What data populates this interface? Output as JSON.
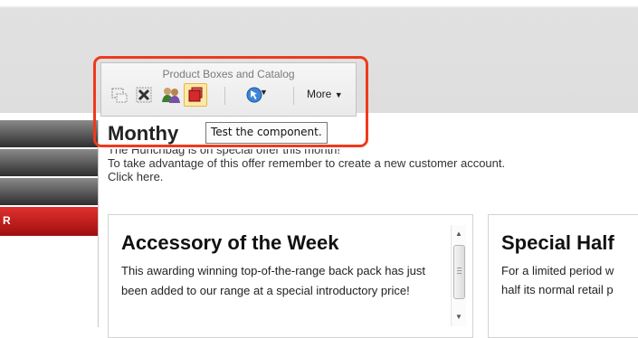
{
  "toolbar": {
    "title": "Product Boxes and Catalog",
    "buttons": [
      {
        "icon": "select-area-icon"
      },
      {
        "icon": "delete-x-icon"
      },
      {
        "icon": "users-icon"
      },
      {
        "icon": "test-component-icon",
        "highlighted": true
      },
      {
        "icon": "cursor-circle-icon",
        "has_dropdown": true
      }
    ],
    "more_label": "More",
    "tooltip": "Test the component.",
    "highlight_color": "#ef3a1c"
  },
  "nav": {
    "items": [
      {
        "label": ""
      },
      {
        "label": ""
      },
      {
        "label": ""
      },
      {
        "label": "R",
        "active": true
      }
    ],
    "active_color": "#c41e1d"
  },
  "content": {
    "title": "Monthy",
    "promo_line1": "The Hunchbag is on special offer this month!",
    "promo_line2": "To take advantage of this offer remember to create a new customer account.",
    "promo_line3": "Click here."
  },
  "boxes": [
    {
      "title": "Accessory of the Week",
      "text": "This awarding winning top-of-the-range back pack has just been added to our range at a special introductory price!"
    },
    {
      "title": "Special Half",
      "line1": "For a limited period w",
      "line2": "half its normal retail p"
    }
  ]
}
